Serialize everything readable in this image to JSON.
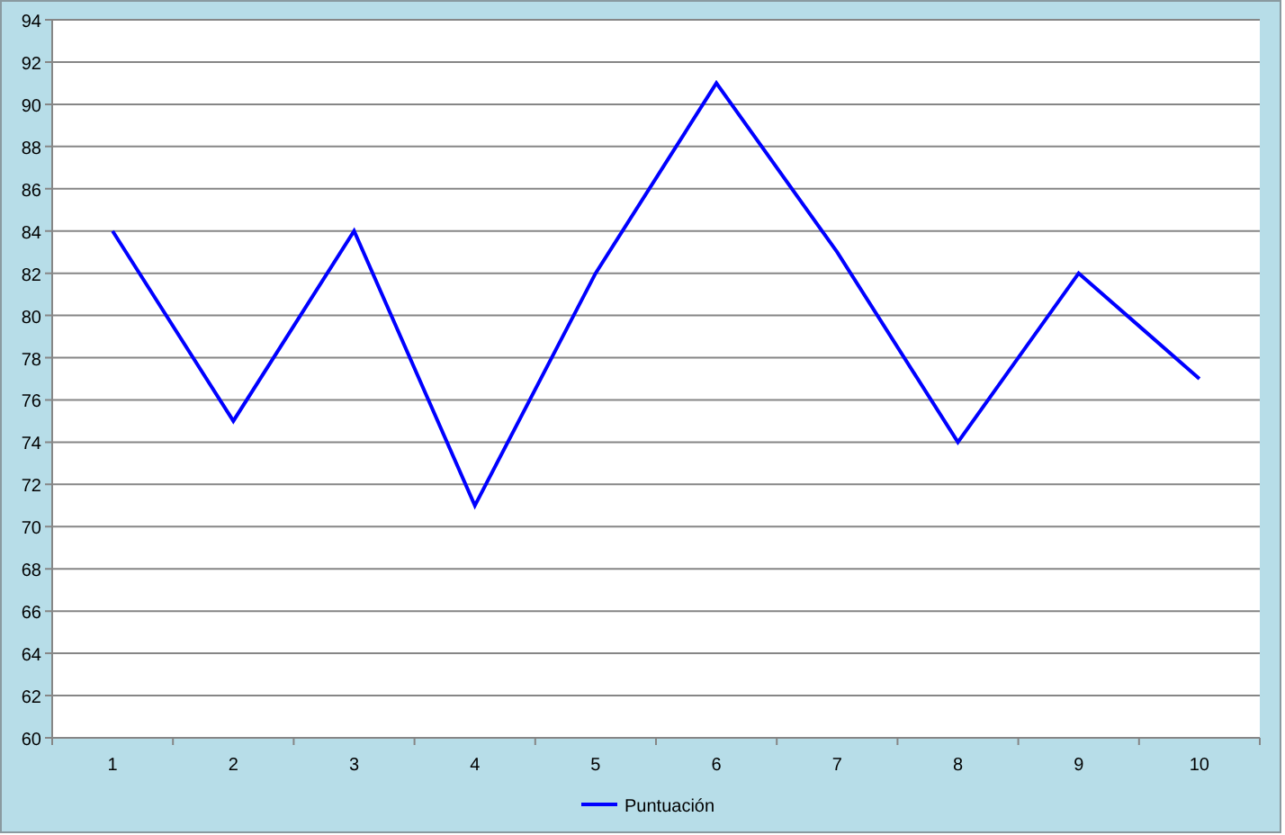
{
  "chart_data": {
    "type": "line",
    "categories": [
      "1",
      "2",
      "3",
      "4",
      "5",
      "6",
      "7",
      "8",
      "9",
      "10"
    ],
    "series": [
      {
        "name": "Puntuación",
        "color": "#0000ff",
        "values": [
          84,
          75,
          84,
          71,
          82,
          91,
          83,
          74,
          82,
          77
        ]
      }
    ],
    "ylim": [
      60,
      94
    ],
    "grid": true,
    "yticks": [
      60,
      62,
      64,
      66,
      68,
      70,
      72,
      74,
      76,
      78,
      80,
      82,
      84,
      86,
      88,
      90,
      92,
      94
    ]
  }
}
